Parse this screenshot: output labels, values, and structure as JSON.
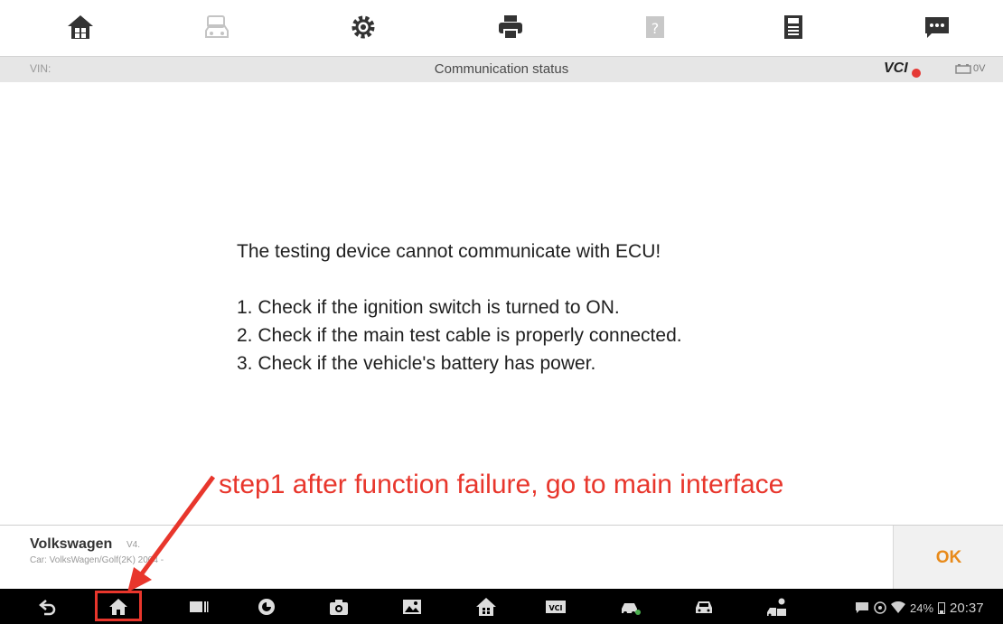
{
  "toolbar": {
    "icons": [
      "home-icon",
      "vehicle-icon",
      "settings-icon",
      "print-icon",
      "help-icon",
      "save-icon",
      "message-icon"
    ]
  },
  "status_bar": {
    "vin_label": "VIN:",
    "title": "Communication status",
    "vci_label": "VCI",
    "voltage": "0V"
  },
  "message": {
    "heading": "The testing device cannot communicate with ECU!",
    "steps": [
      "1. Check if the ignition switch is turned to ON.",
      "2. Check if the main test cable is properly connected.",
      "3. Check if the vehicle's battery has power."
    ]
  },
  "annotation": {
    "text": "step1 after function failure, go to main interface",
    "color": "#e8362c"
  },
  "info_bar": {
    "make": "Volkswagen",
    "version": "V4.",
    "detail": "Car: VolksWagen/Golf(2K) 2004 -",
    "ok_label": "OK"
  },
  "nav_bar": {
    "icons": [
      "back-icon",
      "home-icon",
      "recent-apps-icon",
      "browser-icon",
      "camera-icon",
      "image-icon",
      "app-home-icon",
      "vci-icon",
      "vehicle-diag-icon",
      "car-icon",
      "service-icon"
    ],
    "highlighted": "home-icon",
    "wifi_percent": "24%",
    "time": "20:37"
  },
  "colors": {
    "accent": "#e88a1a",
    "annotation": "#e8362c",
    "status_bar_bg": "#e6e6e6",
    "nav_bg": "#000000"
  }
}
